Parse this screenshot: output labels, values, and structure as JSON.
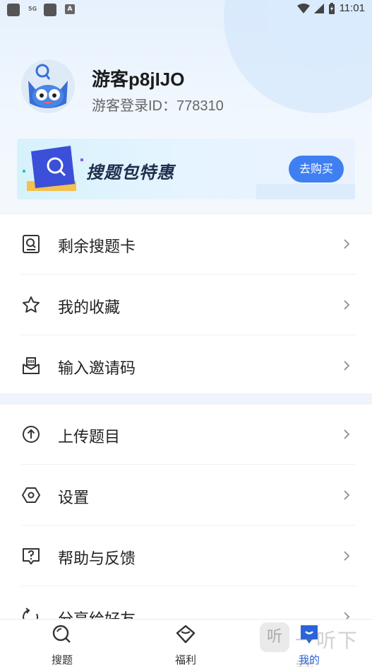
{
  "status_bar": {
    "network": "5G",
    "time": "11:01"
  },
  "profile": {
    "nickname": "游客p8jIJO",
    "guest_id": "游客登录ID：778310"
  },
  "banner": {
    "title": "搜题包特惠",
    "button": "去购买"
  },
  "menu_group1": [
    {
      "label": "剩余搜题卡",
      "icon": "search-card-icon"
    },
    {
      "label": "我的收藏",
      "icon": "star-icon"
    },
    {
      "label": "输入邀请码",
      "icon": "invite-mail-icon"
    }
  ],
  "menu_group2": [
    {
      "label": "上传题目",
      "icon": "upload-icon"
    },
    {
      "label": "设置",
      "icon": "settings-hexagon-icon"
    },
    {
      "label": "帮助与反馈",
      "icon": "help-question-icon"
    },
    {
      "label": "分享给好友",
      "icon": "share-icon"
    }
  ],
  "bottom_nav": [
    {
      "label": "搜题",
      "icon": "search-icon"
    },
    {
      "label": "福利",
      "icon": "gift-tag-icon"
    },
    {
      "label": "我的",
      "icon": "profile-icon",
      "active": true
    }
  ],
  "watermark": {
    "logo": "听",
    "text": "一听下载"
  },
  "colors": {
    "accent": "#3f7ff2",
    "active_tab": "#2b63d9",
    "background": "#eef4fb"
  }
}
